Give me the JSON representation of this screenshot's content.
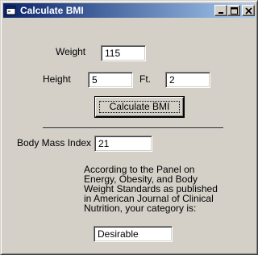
{
  "window": {
    "title": "Calculate BMI",
    "icons": {
      "app": "app-icon",
      "minimize": "minimize-icon",
      "maximize": "maximize-icon",
      "close": "close-icon"
    }
  },
  "form": {
    "weight_label": "Weight",
    "weight_value": "115",
    "height_label": "Height",
    "height_value": "5",
    "feet_label": "Ft.",
    "inches_value": "2",
    "calculate_label": "Calculate BMI",
    "bmi_label": "Body Mass Index",
    "bmi_value": "21",
    "note_text": "According to the Panel on Energy, Obesity, and Body Weight Standards as published in American Journal of Clinical Nutrition, your category is:",
    "category_value": "Desirable"
  }
}
